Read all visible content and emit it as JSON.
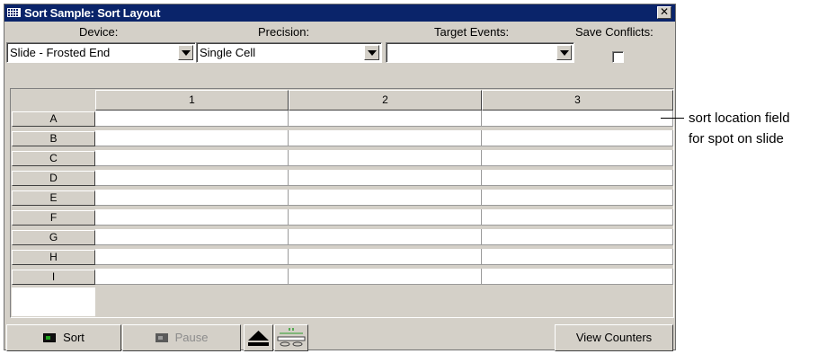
{
  "window": {
    "title": "Sort Sample: Sort Layout",
    "close_label": "✕"
  },
  "labels": {
    "device": "Device:",
    "precision": "Precision:",
    "target_events": "Target Events:",
    "save_conflicts": "Save Conflicts:"
  },
  "fields": {
    "device_value": "Slide - Frosted End",
    "precision_value": "Single Cell",
    "target_events_value": "",
    "save_conflicts_checked": false
  },
  "grid": {
    "columns": [
      "1",
      "2",
      "3"
    ],
    "rows": [
      "A",
      "B",
      "C",
      "D",
      "E",
      "F",
      "G",
      "H",
      "I"
    ]
  },
  "buttons": {
    "sort": "Sort",
    "pause": "Pause",
    "view_counters": "View Counters"
  },
  "annotation": {
    "line1": "sort location field",
    "line2": "for spot on slide"
  },
  "colors": {
    "titlebar": "#0a246a",
    "window_bg": "#d4d0c8",
    "led_green": "#1fa31f"
  }
}
